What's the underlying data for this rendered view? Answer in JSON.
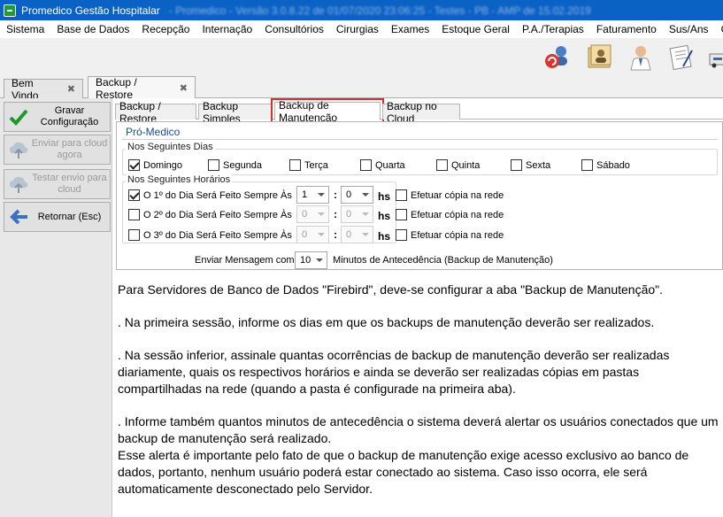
{
  "window": {
    "title": "Promedico Gestão Hospitalar",
    "title_blurred": "- Promedico - Versão 3.0.8.22 de 01/07/2020 23:06:25 - Testes - PB - AMP de 15.02.2019"
  },
  "menu": [
    "Sistema",
    "Base de Dados",
    "Recepção",
    "Internação",
    "Consultórios",
    "Cirurgias",
    "Exames",
    "Estoque Geral",
    "P.A./Terapias",
    "Faturamento",
    "Sus/Ans",
    "Caixa"
  ],
  "toolbar_icons": [
    "users-refresh-icon",
    "patient-record-icon",
    "doctor-icon",
    "prescription-icon",
    "ambulance-icon"
  ],
  "doc_tabs": [
    {
      "label": "Bem Vindo",
      "active": false
    },
    {
      "label": "Backup / Restore",
      "active": true
    }
  ],
  "sidebar": {
    "save": "Gravar Configuração",
    "send_cloud": "Enviar para cloud agora",
    "test_cloud": "Testar envio para cloud",
    "back": "Retornar (Esc)"
  },
  "inner_tabs": [
    {
      "label": "Backup / Restore",
      "active": false
    },
    {
      "label": "Backup Simples",
      "active": false
    },
    {
      "label": "Backup de Manutenção",
      "active": true
    },
    {
      "label": "Backup no Cloud",
      "active": false
    }
  ],
  "panel": {
    "header": "Pró-Medico",
    "days_group": "Nos Seguintes Dias",
    "days": [
      {
        "label": "Domingo",
        "checked": true
      },
      {
        "label": "Segunda",
        "checked": false
      },
      {
        "label": "Terça",
        "checked": false
      },
      {
        "label": "Quarta",
        "checked": false
      },
      {
        "label": "Quinta",
        "checked": false
      },
      {
        "label": "Sexta",
        "checked": false
      },
      {
        "label": "Sábado",
        "checked": false
      }
    ],
    "hours_group": "Nos Seguintes Horários",
    "schedules": [
      {
        "label": "O 1º do Dia Será Feito Sempre Às",
        "checked": true,
        "hour": "1",
        "minute": "0",
        "enabled": true
      },
      {
        "label": "O 2º do Dia Será Feito Sempre Às",
        "checked": false,
        "hour": "0",
        "minute": "0",
        "enabled": false
      },
      {
        "label": "O 3º do Dia Será Feito Sempre Às",
        "checked": false,
        "hour": "0",
        "minute": "0",
        "enabled": false
      }
    ],
    "hs_label": "hs",
    "colon": ":",
    "network_copy_label": "Efetuar cópia na rede",
    "send_msg_label": "Enviar Mensagem com",
    "send_msg_value": "10",
    "minutes_label": "Minutos de Antecedência (Backup de Manutenção)"
  },
  "help_text": {
    "p1": "Para Servidores de Banco de Dados \"Firebird\", deve-se configurar a aba \"Backup de Manutenção\".",
    "p2": ". Na primeira sessão, informe os dias em que os backups de manutenção deverão ser realizados.",
    "p3": ". Na sessão inferior, assinale quantas ocorrências de backup de manutenção deverão ser realizadas diariamente, quais os respectivos horários e ainda se deverão ser realizadas cópias em pastas compartilhadas na rede (quando a pasta é configurade na primeira aba).",
    "p4": ". Informe também quantos minutos de antecedência o sistema deverá alertar os usuários conectados que um backup de manutenção será realizado.",
    "p5": "Esse alerta é importante pelo fato de que o backup de manutenção exige acesso exclusivo ao banco de dados, portanto, nenhum usuário poderá estar conectado ao sistema.  Caso isso ocorra, ele será automaticamente desconectado pelo Servidor."
  },
  "colors": {
    "titlebar": "#0a62c4",
    "highlight_outline": "#d9302c",
    "panel_header_text": "#1a4a9a"
  }
}
